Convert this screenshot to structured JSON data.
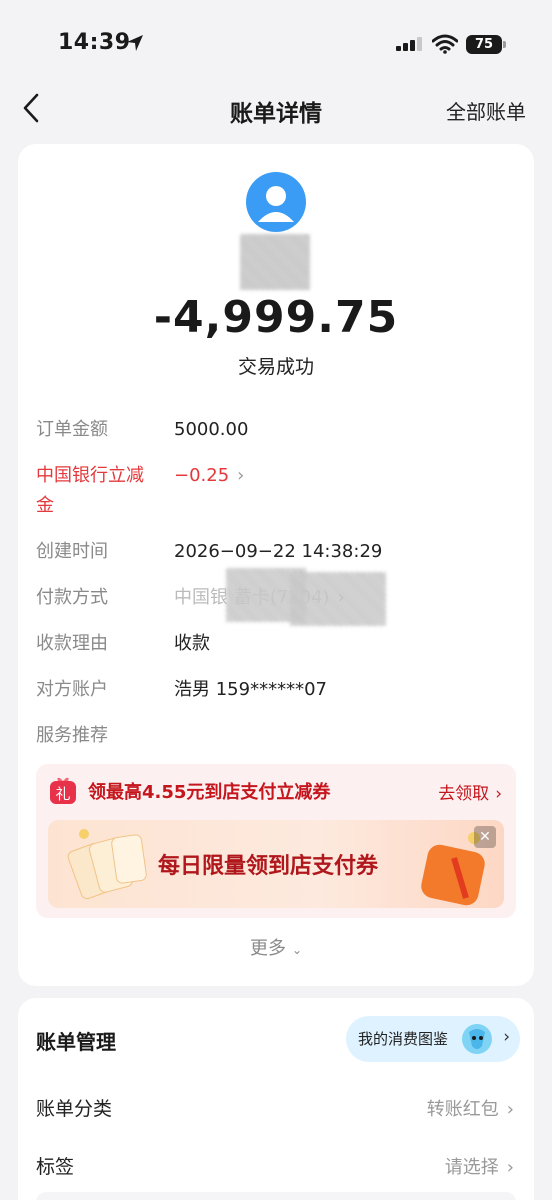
{
  "status_bar": {
    "time": "14:39",
    "battery": "75"
  },
  "nav": {
    "title": "账单详情",
    "right_label": "全部账单"
  },
  "summary": {
    "amount": "-4,999.75",
    "status": "交易成功"
  },
  "details": {
    "order_amount_label": "订单金额",
    "order_amount_value": "5000.00",
    "discount_label_line1": "中国银行立减",
    "discount_label_line2": "金",
    "discount_value": "−0.25",
    "created_label": "创建时间",
    "created_value": "2026−09−22 14:38:29",
    "payment_label": "付款方式",
    "payment_value": "中国银   蓄卡(7204)",
    "reason_label": "收款理由",
    "reason_value": "收款",
    "counterparty_label": "对方账户",
    "counterparty_value": "浩男 159******07",
    "service_label": "服务推荐"
  },
  "promo": {
    "text": "领最高4.55元到店支付立减券",
    "link": "去领取",
    "banner_text": "每日限量领到店支付券",
    "gift_char": "礼"
  },
  "more_label": "更多",
  "management": {
    "title": "账单管理",
    "pill_text": "我的消费图鉴",
    "category_label": "账单分类",
    "category_value": "转账红包",
    "tag_label": "标签",
    "tag_value": "请选择"
  },
  "colors": {
    "accent_red": "#e4393c",
    "promo_red": "#c4161c",
    "avatar_blue": "#3a9cf5"
  }
}
